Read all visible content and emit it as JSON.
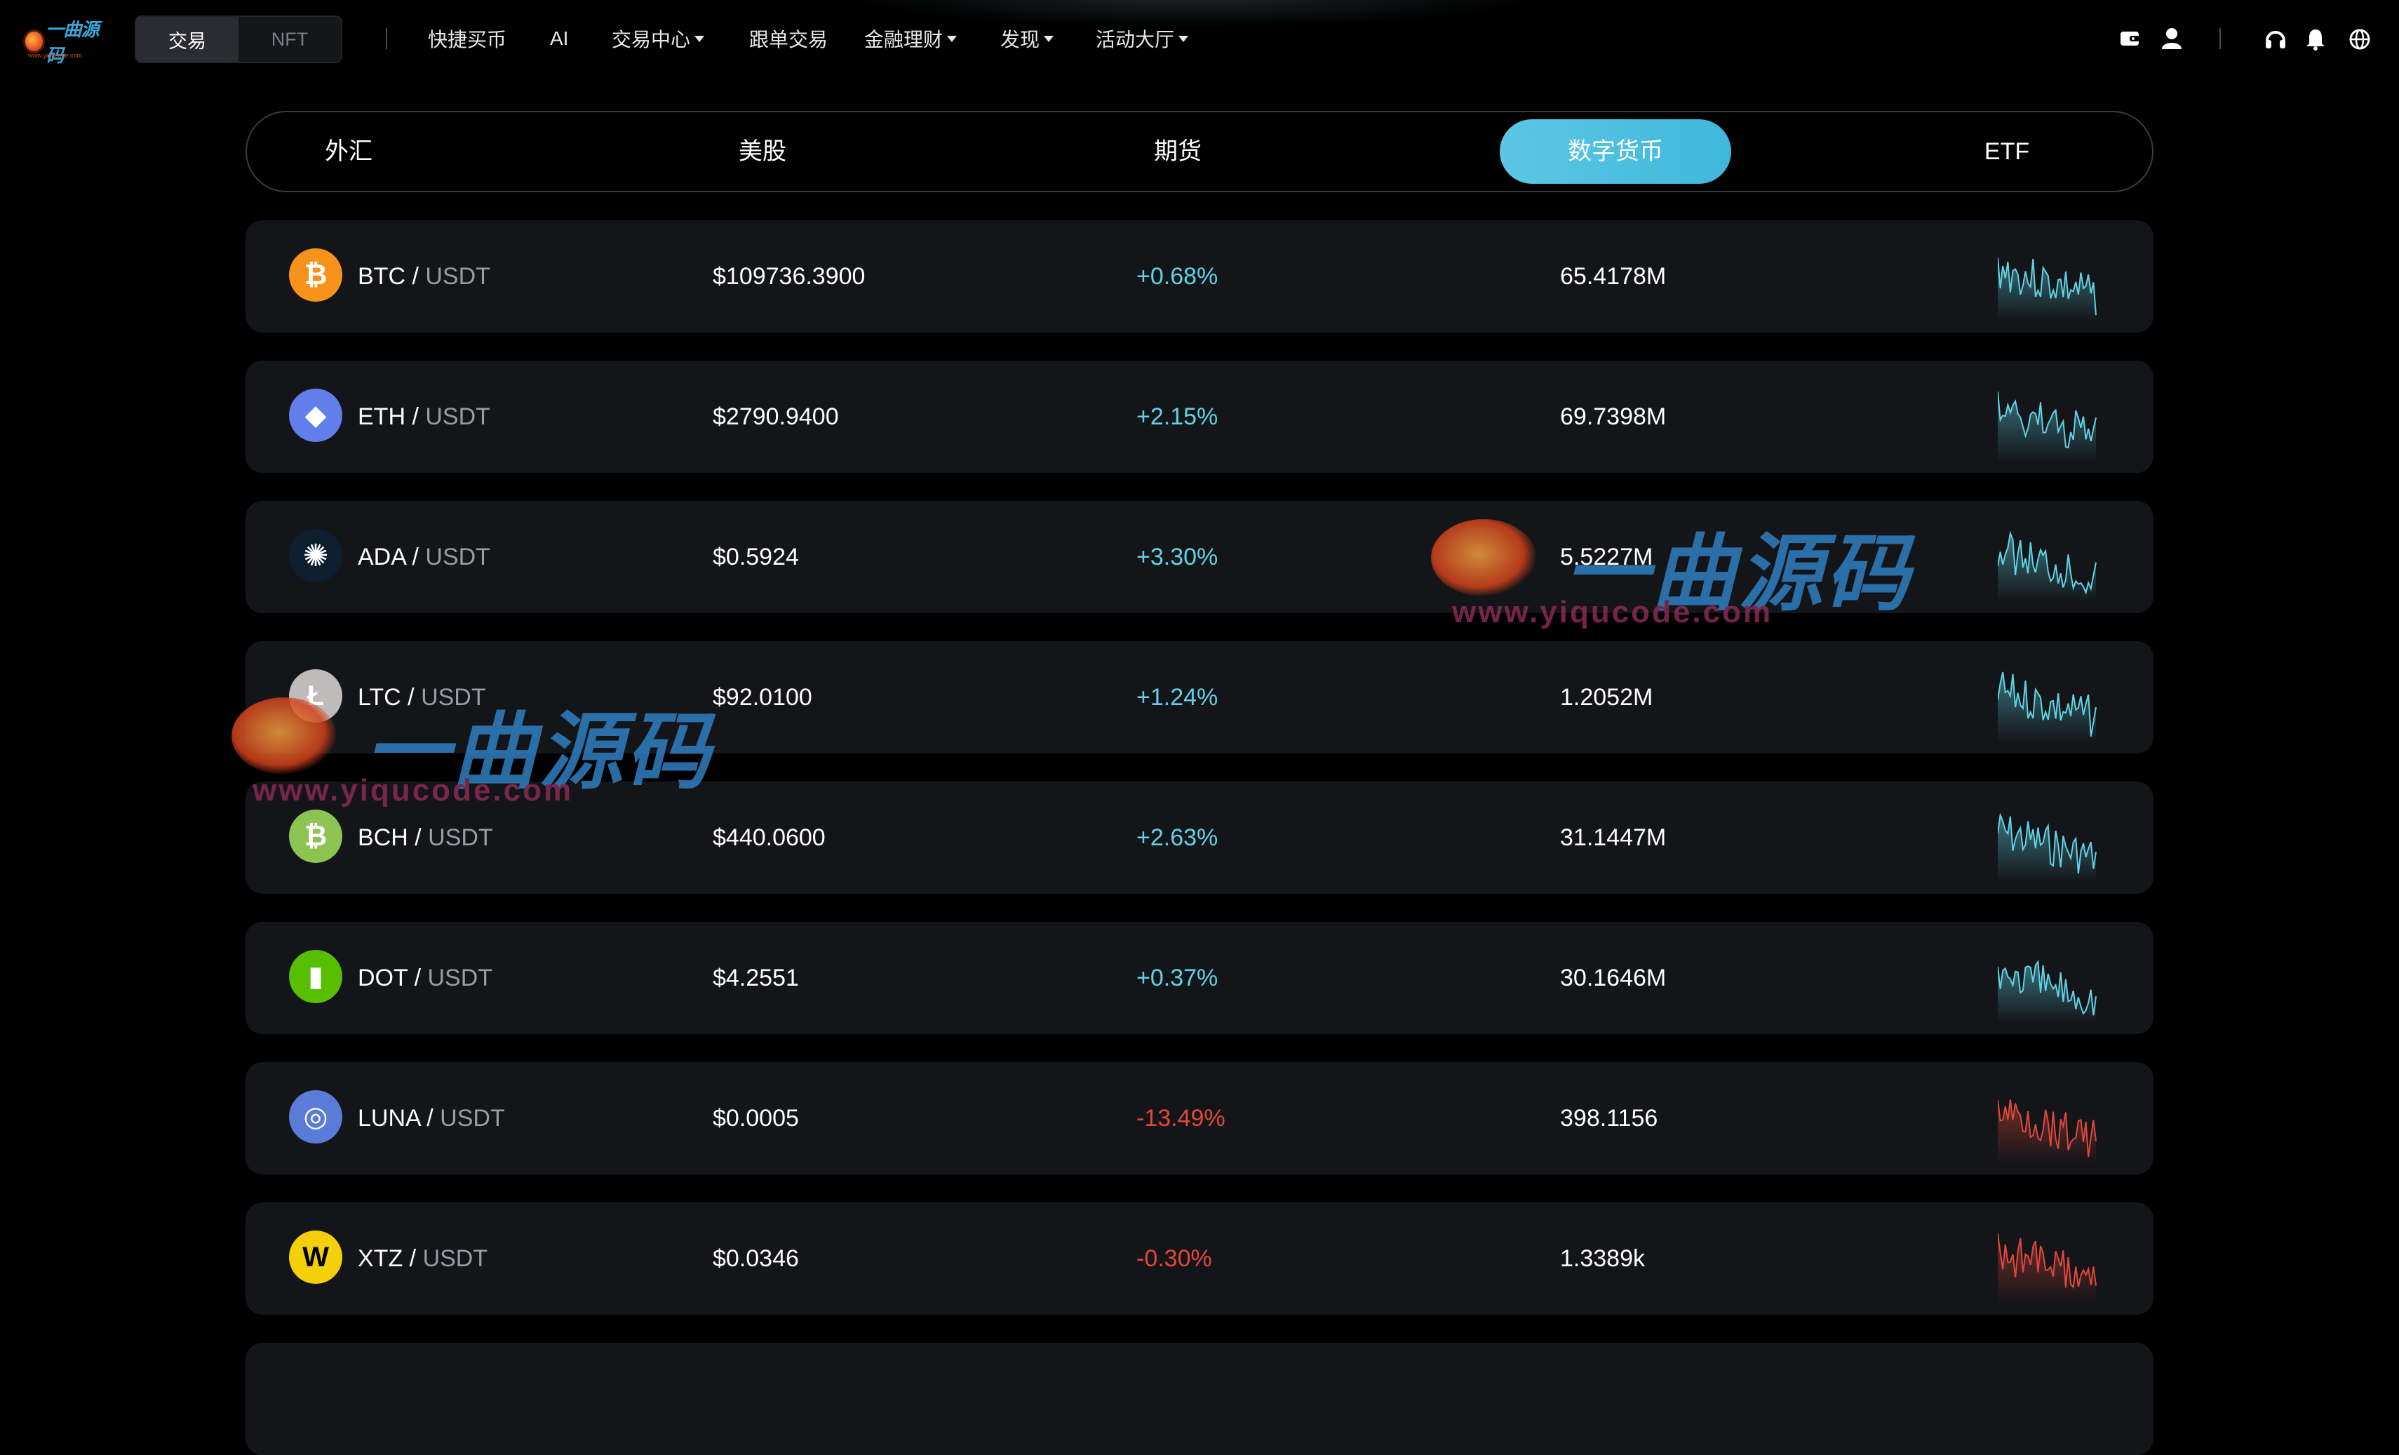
{
  "logo": {
    "text": "一曲源码",
    "url": "www.yiqucode.com"
  },
  "mode_toggle": {
    "options": [
      "交易",
      "NFT"
    ],
    "active": "交易"
  },
  "nav": {
    "items": [
      {
        "label": "快捷买币",
        "dropdown": false
      },
      {
        "label": "AI",
        "dropdown": false
      },
      {
        "label": "交易中心",
        "dropdown": true
      },
      {
        "label": "跟单交易",
        "dropdown": false
      },
      {
        "label": "金融理财",
        "dropdown": true
      },
      {
        "label": "发现",
        "dropdown": true
      },
      {
        "label": "活动大厅",
        "dropdown": true
      }
    ]
  },
  "header_icons": [
    "wallet-icon",
    "user-icon",
    "headset-icon",
    "bell-icon",
    "globe-icon"
  ],
  "tabs": {
    "items": [
      "外汇",
      "美股",
      "期货",
      "数字货币",
      "ETF"
    ],
    "active": "数字货币"
  },
  "colors": {
    "accent": "#4fc1df",
    "up": "#5fd3e5",
    "down": "#e0483b",
    "row_bg": "#141519"
  },
  "rows": [
    {
      "base": "BTC",
      "quote": "USDT",
      "price": "$109736.3900",
      "change": "+0.68%",
      "direction": "up",
      "volume": "65.4178M",
      "icon": "bitcoin-icon",
      "icon_color": "#f7931a",
      "icon_glyph": "₿"
    },
    {
      "base": "ETH",
      "quote": "USDT",
      "price": "$2790.9400",
      "change": "+2.15%",
      "direction": "up",
      "volume": "69.7398M",
      "icon": "ethereum-icon",
      "icon_color": "#627eea",
      "icon_glyph": "◆"
    },
    {
      "base": "ADA",
      "quote": "USDT",
      "price": "$0.5924",
      "change": "+3.30%",
      "direction": "up",
      "volume": "5.5227M",
      "icon": "cardano-icon",
      "icon_color": "#0d1e30",
      "icon_glyph": "✺"
    },
    {
      "base": "LTC",
      "quote": "USDT",
      "price": "$92.0100",
      "change": "+1.24%",
      "direction": "up",
      "volume": "1.2052M",
      "icon": "litecoin-icon",
      "icon_color": "#bfbbbb",
      "icon_glyph": "Ł"
    },
    {
      "base": "BCH",
      "quote": "USDT",
      "price": "$440.0600",
      "change": "+2.63%",
      "direction": "up",
      "volume": "31.1447M",
      "icon": "bitcoin-cash-icon",
      "icon_color": "#8dc351",
      "icon_glyph": "₿"
    },
    {
      "base": "DOT",
      "quote": "USDT",
      "price": "$4.2551",
      "change": "+0.37%",
      "direction": "up",
      "volume": "30.1646M",
      "icon": "neo-icon",
      "icon_color": "#58bf00",
      "icon_glyph": "▮"
    },
    {
      "base": "LUNA",
      "quote": "USDT",
      "price": "$0.0005",
      "change": "-13.49%",
      "direction": "down",
      "volume": "398.1156",
      "icon": "luna-icon",
      "icon_color": "#5a7bd8",
      "icon_glyph": "◎"
    },
    {
      "base": "XTZ",
      "quote": "USDT",
      "price": "$0.0346",
      "change": "-0.30%",
      "direction": "down",
      "volume": "1.3389k",
      "icon": "xtz-icon",
      "icon_color": "#f3d008",
      "icon_glyph": "W"
    }
  ]
}
